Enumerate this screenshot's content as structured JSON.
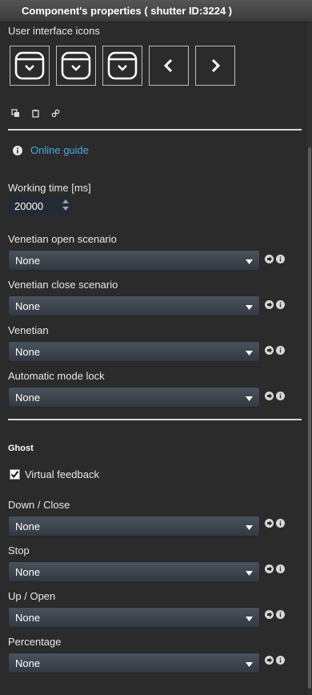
{
  "title": "Component's properties ( shutter ID:3224 )",
  "ui_icons": {
    "label": "User interface icons",
    "tiles": [
      "shutter-icon",
      "shutter-icon",
      "shutter-icon",
      "chevron-left-icon",
      "chevron-right-icon"
    ]
  },
  "tools": [
    "copy-icon",
    "clipboard-icon",
    "link-icon"
  ],
  "online_guide": "Online guide",
  "working_time": {
    "label": "Working time [ms]",
    "value": "20000"
  },
  "scenarios": [
    {
      "label": "Venetian open scenario",
      "value": "None"
    },
    {
      "label": "Venetian close scenario",
      "value": "None"
    },
    {
      "label": "Venetian",
      "value": "None"
    },
    {
      "label": "Automatic mode lock",
      "value": "None"
    }
  ],
  "ghost": {
    "heading": "Ghost",
    "virtual_feedback": {
      "label": "Virtual feedback",
      "checked": true
    },
    "fields": [
      {
        "label": "Down / Close",
        "value": "None"
      },
      {
        "label": "Stop",
        "value": "None"
      },
      {
        "label": "Up / Open",
        "value": "None"
      },
      {
        "label": "Percentage",
        "value": "None"
      }
    ]
  },
  "colors": {
    "link": "#4aa8e0",
    "background": "#2b2b2b",
    "select": "#3f464f"
  }
}
